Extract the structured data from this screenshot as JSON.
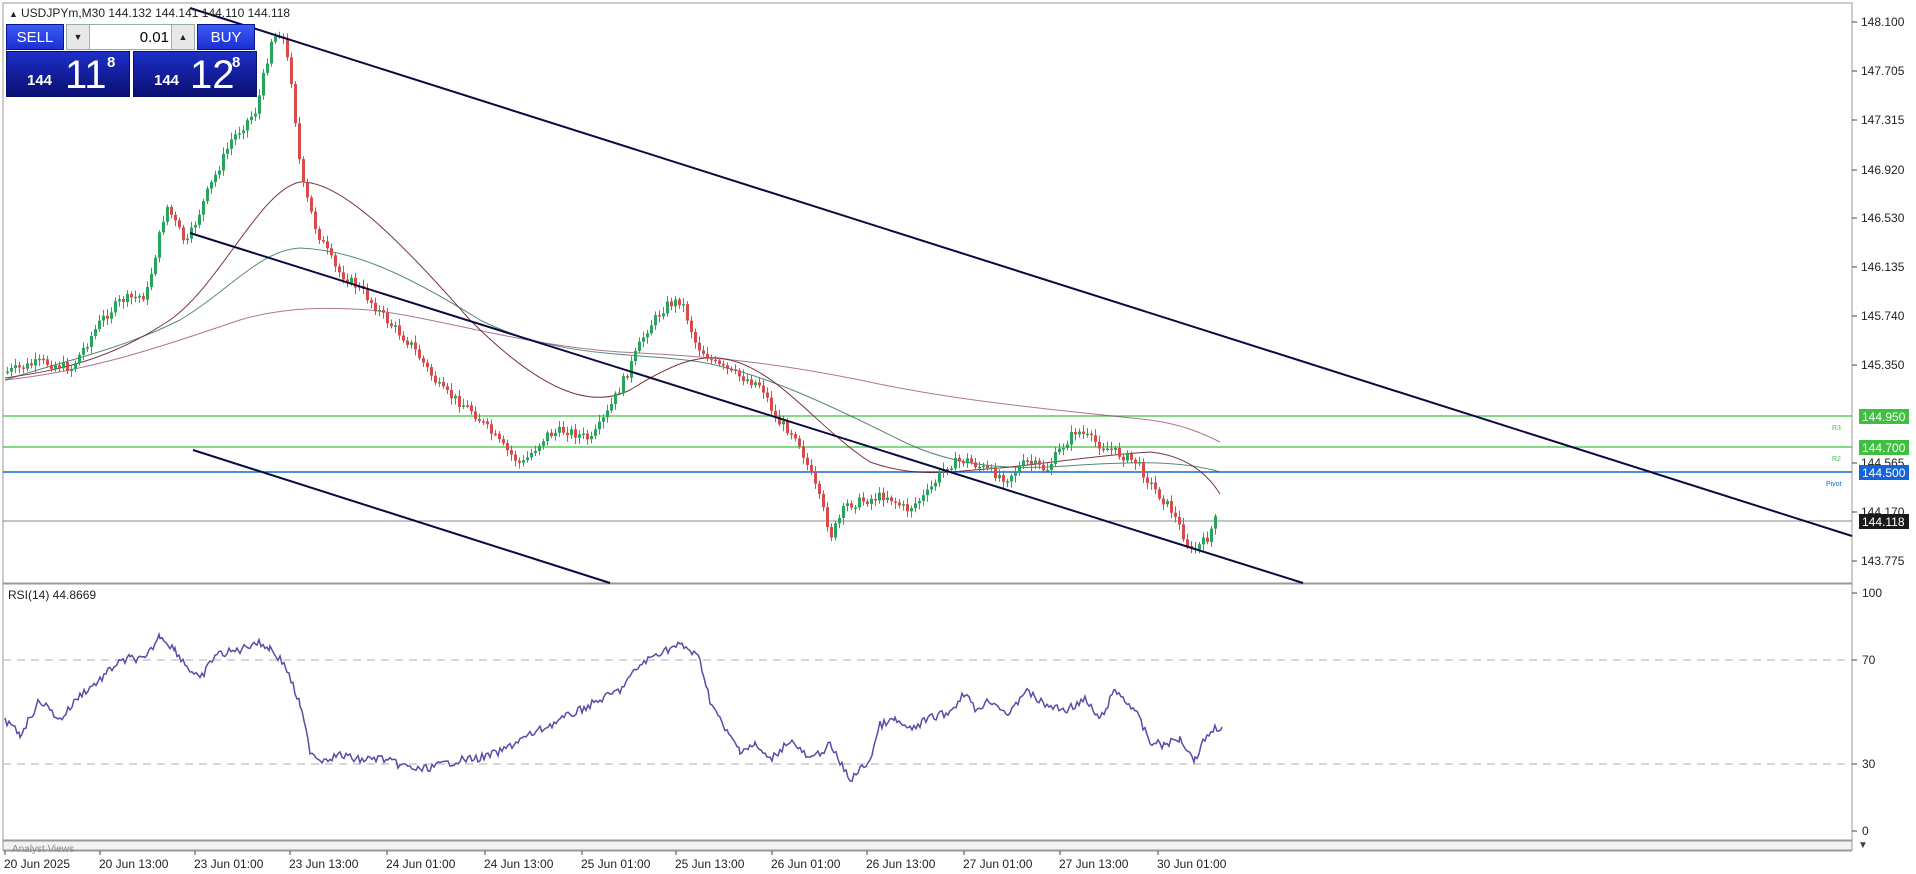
{
  "symbol_header": "USDJPYm,M30  144.132 144.141 144.110 144.118",
  "trade_panel": {
    "sell_label": "SELL",
    "buy_label": "BUY",
    "lot": "0.01",
    "sell_price": {
      "prefix": "144",
      "big": "11",
      "sup": "8"
    },
    "buy_price": {
      "prefix": "144",
      "big": "12",
      "sup": "8"
    }
  },
  "price_axis": {
    "ticks": [
      "148.100",
      "147.705",
      "147.315",
      "146.920",
      "146.530",
      "146.135",
      "145.740",
      "145.350",
      "144.565",
      "144.170",
      "143.775"
    ],
    "current_price": "144.118"
  },
  "levels": [
    {
      "name": "R3",
      "value": "144.950",
      "color": "#3fbf3f"
    },
    {
      "name": "R2",
      "value": "144.700",
      "color": "#3fbf3f"
    },
    {
      "name": "Pivot",
      "value": "144.500",
      "color": "#1565d8"
    }
  ],
  "rsi": {
    "label": "RSI(14) 44.8669",
    "ticks": [
      "100",
      "70",
      "30",
      "0"
    ],
    "overbought": 70,
    "oversold": 30
  },
  "time_axis": {
    "labels": [
      "20 Jun 2025",
      "20 Jun 13:00",
      "23 Jun 01:00",
      "23 Jun 13:00",
      "24 Jun 01:00",
      "24 Jun 13:00",
      "25 Jun 01:00",
      "25 Jun 13:00",
      "26 Jun 01:00",
      "26 Jun 13:00",
      "27 Jun 01:00",
      "27 Jun 13:00",
      "30 Jun 01:00"
    ]
  },
  "analyst_tab": "Analyst Views",
  "colors": {
    "bull": "#26a65b",
    "bear": "#d94b4b",
    "channel": "#0a0a40",
    "rsi_line": "#5b4aa8",
    "current_price_bg": "#1a1a1a"
  }
}
